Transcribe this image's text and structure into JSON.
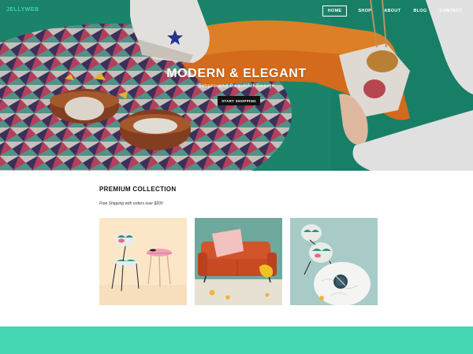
{
  "brand": {
    "logo": "JELLYWEB"
  },
  "nav": {
    "items": [
      {
        "label": "HOME",
        "active": true
      },
      {
        "label": "SHOP",
        "active": false
      },
      {
        "label": "ABOUT",
        "active": false
      },
      {
        "label": "BLOG",
        "active": false
      },
      {
        "label": "CONTACT",
        "active": false
      }
    ]
  },
  "hero": {
    "title": "MODERN & ELEGANT",
    "subtitle": "Simple and Beautiful Design",
    "cta_label": "START SHOPPING"
  },
  "collection": {
    "title": "PREMIUM COLLECTION",
    "note": "Free Shipping with orders over $200",
    "products": [
      {
        "image": "chair-and-pink-table"
      },
      {
        "image": "orange-sofa-with-pink-pillow"
      },
      {
        "image": "chair-and-marble-table-topview"
      }
    ]
  },
  "colors": {
    "accent": "#44d6b3",
    "logo": "#3fd3ad",
    "hero_green": "#1f9878",
    "button": "#111111"
  }
}
